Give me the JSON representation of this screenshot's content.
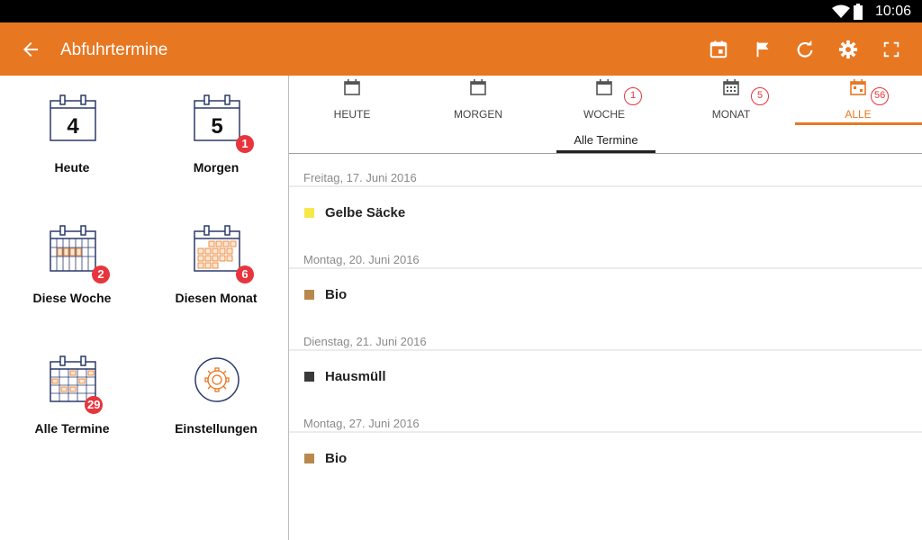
{
  "status": {
    "time": "10:06"
  },
  "appbar": {
    "title": "Abfuhrtermine",
    "icons": [
      "back-icon",
      "calendar-today-icon",
      "flag-icon",
      "refresh-icon",
      "settings-icon",
      "fullscreen-icon"
    ]
  },
  "sidebar": {
    "items": [
      {
        "label": "Heute",
        "day": "4",
        "badge": ""
      },
      {
        "label": "Morgen",
        "day": "5",
        "badge": "1"
      },
      {
        "label": "Diese Woche",
        "badge": "2"
      },
      {
        "label": "Diesen Monat",
        "badge": "6"
      },
      {
        "label": "Alle Termine",
        "badge": "29"
      },
      {
        "label": "Einstellungen",
        "badge": ""
      }
    ]
  },
  "tabs": [
    {
      "label": "HEUTE",
      "badge": ""
    },
    {
      "label": "MORGEN",
      "badge": ""
    },
    {
      "label": "WOCHE",
      "badge": "1"
    },
    {
      "label": "MONAT",
      "badge": "5"
    },
    {
      "label": "ALLE",
      "badge": "56"
    }
  ],
  "subtab": {
    "label": "Alle Termine"
  },
  "colors": {
    "accent": "#E87722",
    "badge": "#e8353d"
  },
  "list": [
    {
      "date": "Freitag, 17. Juni 2016",
      "entries": [
        {
          "label": "Gelbe Säcke",
          "color": "#f7e84a"
        }
      ]
    },
    {
      "date": "Montag, 20. Juni 2016",
      "entries": [
        {
          "label": "Bio",
          "color": "#b8894d"
        }
      ]
    },
    {
      "date": "Dienstag, 21. Juni 2016",
      "entries": [
        {
          "label": "Hausmüll",
          "color": "#3a3a3a"
        }
      ]
    },
    {
      "date": "Montag, 27. Juni 2016",
      "entries": [
        {
          "label": "Bio",
          "color": "#b8894d"
        }
      ]
    }
  ]
}
